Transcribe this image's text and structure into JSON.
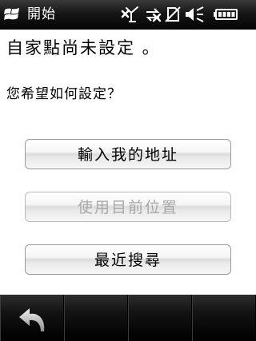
{
  "status_bar": {
    "start_label": "開始",
    "icons": [
      "start-windows-icon",
      "signal-off-icon",
      "data-off-icon",
      "no-sim-icon",
      "volume-icon",
      "battery-icon"
    ]
  },
  "content": {
    "heading": "自家點尚未設定 。",
    "question": "您希望如何設定？"
  },
  "buttons": {
    "enter_address": {
      "label": "輸入我的地址",
      "enabled": true
    },
    "use_location": {
      "label": "使用目前位置",
      "enabled": false
    },
    "recent_search": {
      "label": "最近搜尋",
      "enabled": true
    }
  },
  "softkeys": {
    "icons": [
      "back-icon",
      "",
      "",
      ""
    ]
  },
  "colors": {
    "bar_dark": "#0a0a0a",
    "disabled_text": "#a8a8a8",
    "battery_fill": "#ffffff"
  }
}
